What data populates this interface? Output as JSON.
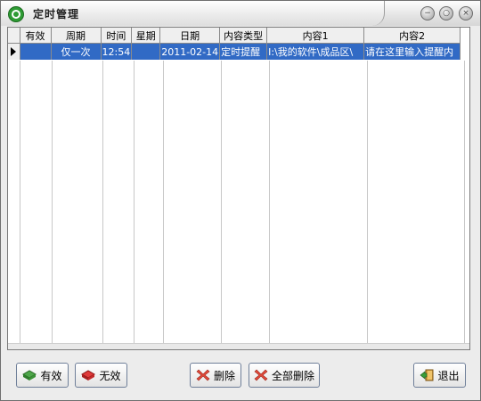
{
  "window": {
    "title": "定时管理"
  },
  "grid": {
    "headers": [
      "有效",
      "周期",
      "时间",
      "星期",
      "日期",
      "内容类型",
      "内容1",
      "内容2"
    ],
    "rows": [
      {
        "valid": "",
        "cycle": "仅一次",
        "time": "12:54",
        "weekday": "",
        "date": "2011-02-14",
        "type": "定时提醒",
        "content1": "I:\\我的软件\\成品区\\",
        "content2": "请在这里输入提醒内"
      }
    ]
  },
  "buttons": {
    "enable": "有效",
    "disable": "无效",
    "delete": "删除",
    "delete_all": "全部删除",
    "exit": "退出"
  }
}
